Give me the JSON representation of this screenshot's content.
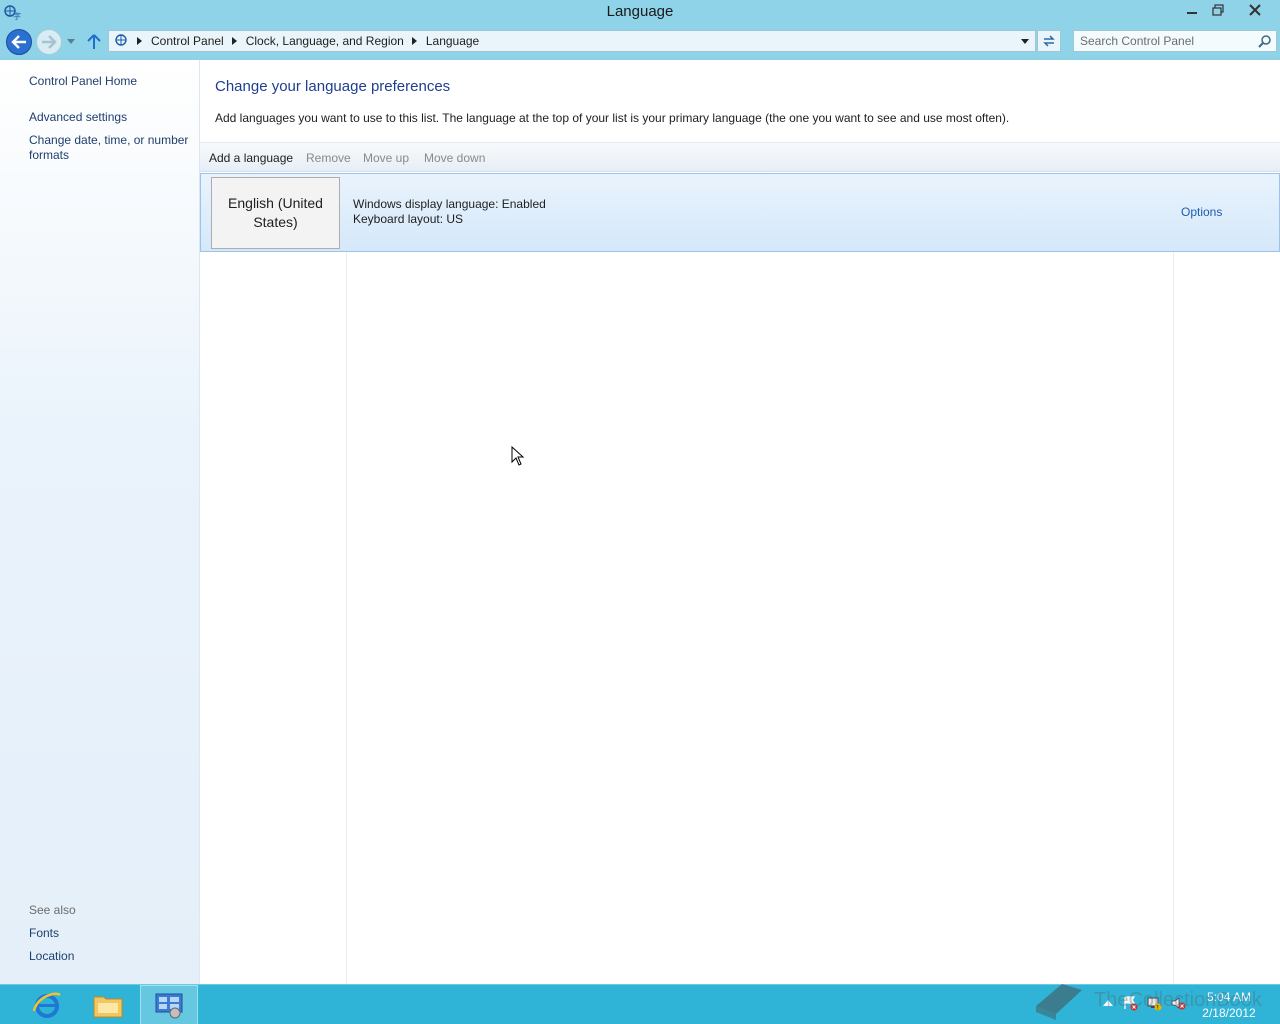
{
  "window": {
    "title": "Language"
  },
  "navbar": {
    "breadcrumbs": [
      "Control Panel",
      "Clock, Language, and Region",
      "Language"
    ],
    "search_placeholder": "Search Control Panel"
  },
  "sidebar": {
    "home": "Control Panel Home",
    "advanced": "Advanced settings",
    "datetime_line1": "Change date, time, or number",
    "datetime_line2": "formats",
    "see_also": "See also",
    "fonts": "Fonts",
    "location": "Location"
  },
  "main": {
    "heading": "Change your language preferences",
    "description": "Add languages you want to use to this list. The language at the top of your list is your primary language (the one you want to see and use most often).",
    "toolbar": {
      "add": "Add a language",
      "remove": "Remove",
      "move_up": "Move up",
      "move_down": "Move down"
    },
    "languages": [
      {
        "name": "English (United States)",
        "display_language": "Windows display language: Enabled",
        "keyboard": "Keyboard layout: US",
        "options": "Options"
      }
    ]
  },
  "taskbar": {
    "time": "5:04 AM",
    "date": "2/18/2012",
    "watermark": "TheCollectionBook"
  },
  "colors": {
    "titlebar": "#8fd3e8",
    "taskbar": "#2fb3d6",
    "link": "#1e3f6d",
    "heading": "#1e3f8f",
    "selected_row": "#d5e8fa"
  }
}
